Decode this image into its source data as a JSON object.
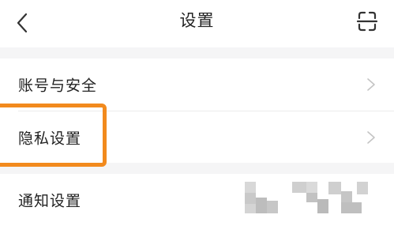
{
  "header": {
    "title": "设置",
    "back_icon": "chevron-left-icon",
    "scan_icon": "scan-icon"
  },
  "settings": {
    "items": [
      {
        "label": "账号与安全",
        "chevron": true
      },
      {
        "label": "隐私设置",
        "chevron": true,
        "highlighted": true
      },
      {
        "label": "通知设置",
        "chevron": false
      }
    ]
  },
  "colors": {
    "highlight": "#f28a1d",
    "section_gap": "#f5f5f6",
    "text": "#222222",
    "chevron": "#c4c4c4"
  }
}
